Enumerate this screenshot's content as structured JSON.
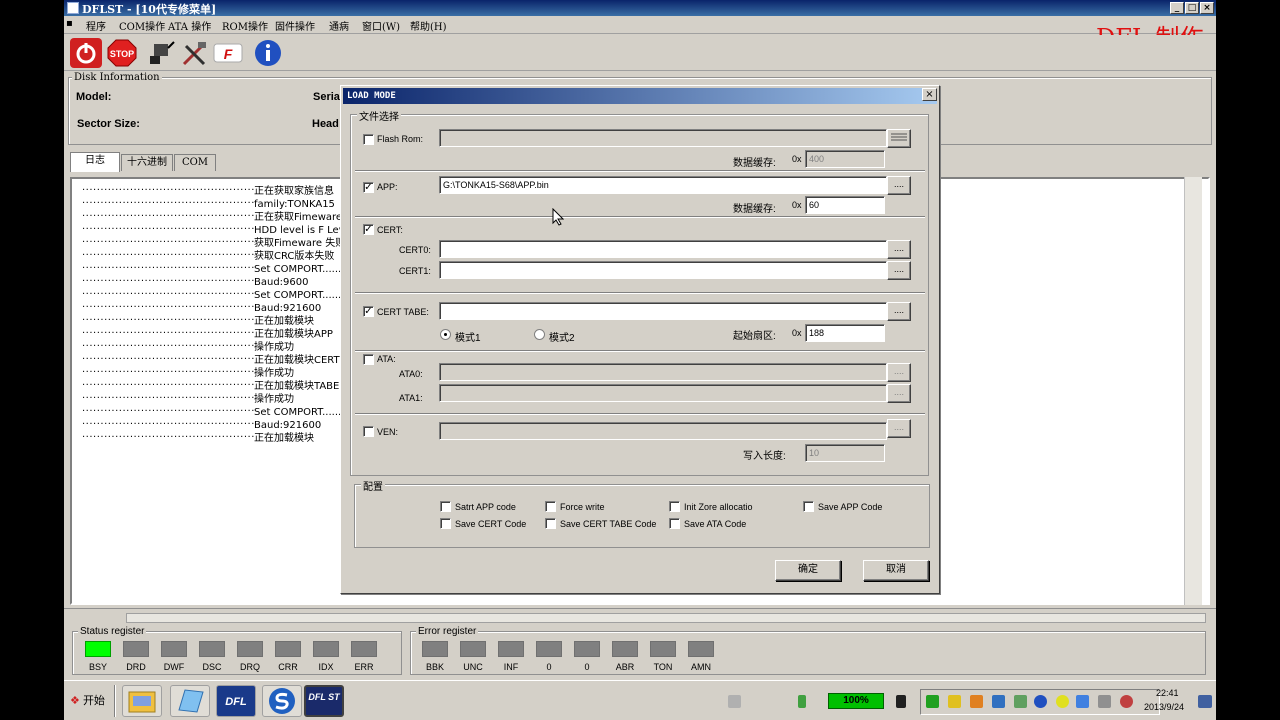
{
  "window": {
    "title": "DFLST - [10代专修菜单]"
  },
  "menu": [
    "程序",
    "COM操作",
    "ATA 操作",
    "ROM操作",
    "固件操作",
    "通病",
    "窗口(W)",
    "帮助(H)"
  ],
  "watermark": "DFL 制作",
  "toolbar": {
    "icons": [
      "power-icon",
      "stop-icon",
      "connect-icon",
      "tools-icon",
      "f-logo-icon",
      "info-icon"
    ],
    "stop_label": "STOP",
    "f_label": "F"
  },
  "disk_info": {
    "title": "Disk Information",
    "model_label": "Model:",
    "serial_label": "Seria",
    "sector_label": "Sector Size:",
    "head_label": "Head"
  },
  "tabs": [
    "日志",
    "十六进制",
    "COM"
  ],
  "log": [
    {
      "dots": "........................................................",
      "text": "正在获取家族信息"
    },
    {
      "dots": "........................................................",
      "text": "family:TONKA15"
    },
    {
      "dots": "........................................................",
      "text": "正在获取Fimeware"
    },
    {
      "dots": "........................................................",
      "text": "HDD level is F Leve"
    },
    {
      "dots": "........................................................",
      "text": "获取Fimeware 失败"
    },
    {
      "dots": "........................................................",
      "text": "获取CRC版本失败"
    },
    {
      "dots": "........................................................",
      "text": "Set COMPORT......"
    },
    {
      "dots": "........................................................",
      "text": "Baud:9600"
    },
    {
      "dots": "........................................................",
      "text": "Set COMPORT......"
    },
    {
      "dots": "........................................................",
      "text": "Baud:921600"
    },
    {
      "dots": "........................................................",
      "text": "正在加载模块"
    },
    {
      "dots": "........................................................",
      "text": "正在加载模块APP"
    },
    {
      "dots": "........................................................",
      "text": "操作成功"
    },
    {
      "dots": "........................................................",
      "text": "正在加载模块CERT"
    },
    {
      "dots": "........................................................",
      "text": "操作成功"
    },
    {
      "dots": "........................................................",
      "text": "正在加载模块TABE"
    },
    {
      "dots": "........................................................",
      "text": "操作成功"
    },
    {
      "dots": "........................................................",
      "text": "Set COMPORT......"
    },
    {
      "dots": "........................................................",
      "text": "Baud:921600"
    },
    {
      "dots": "........................................................",
      "text": "正在加载模块"
    }
  ],
  "status_register": {
    "title": "Status register",
    "leds": [
      "BSY",
      "DRD",
      "DWF",
      "DSC",
      "DRQ",
      "CRR",
      "IDX",
      "ERR"
    ]
  },
  "error_register": {
    "title": "Error register",
    "leds": [
      "BBK",
      "UNC",
      "INF",
      "0",
      "0",
      "ABR",
      "TON",
      "AMN"
    ]
  },
  "dialog": {
    "title": "LOAD MODE",
    "file_group": "文件选择",
    "flash_rom": {
      "label": "Flash Rom:",
      "value": "",
      "buffer_label": "数据缓存:",
      "hex": "0x",
      "buffer": "400"
    },
    "app": {
      "label": "APP:",
      "value": "G:\\TONKA15-S68\\APP.bin",
      "buffer_label": "数据缓存:",
      "hex": "0x",
      "buffer": "60"
    },
    "cert": {
      "label": "CERT:",
      "cert0_label": "CERT0:",
      "cert1_label": "CERT1:"
    },
    "cert_tabe": {
      "label": "CERT TABE:",
      "mode1": "模式1",
      "mode2": "模式2",
      "start_label": "起始扇区:",
      "hex": "0x",
      "start": "188"
    },
    "ata": {
      "label": "ATA:",
      "ata0_label": "ATA0:",
      "ata1_label": "ATA1:"
    },
    "ven": {
      "label": "VEN:",
      "write_label": "写入长度:",
      "write": "10"
    },
    "browse": "....",
    "config_group": "配置",
    "options": [
      "Satrt APP code",
      "Force write",
      "Init Zore allocatio",
      "Save APP Code",
      "Save CERT Code",
      "Save CERT TABE Code",
      "Save ATA Code"
    ],
    "ok": "确定",
    "cancel": "取消"
  },
  "taskbar": {
    "start": "开始",
    "battery": "100%",
    "time": "22:41",
    "date": "2013/9/24",
    "dfl_label": "DFL",
    "dflst_label": "DFL ST"
  }
}
